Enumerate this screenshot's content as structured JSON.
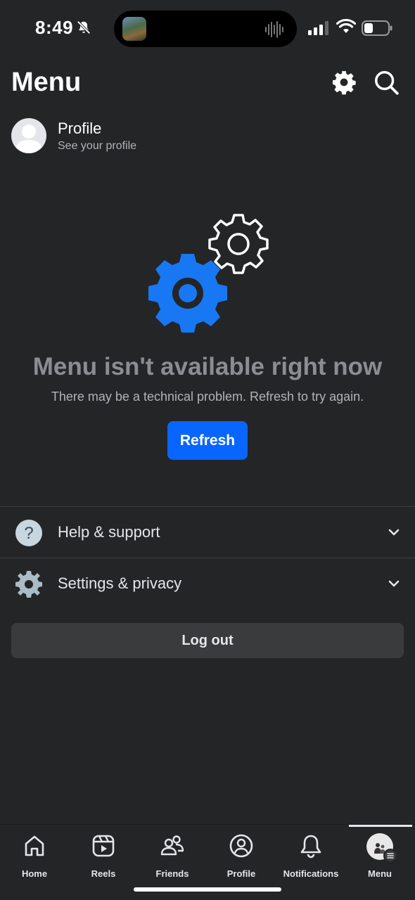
{
  "status_bar": {
    "time": "8:49",
    "icons": [
      "bell-slash-icon",
      "signal-icon",
      "wifi-icon",
      "battery-icon"
    ]
  },
  "header": {
    "title": "Menu",
    "icons": [
      "gear-icon",
      "search-icon"
    ]
  },
  "profile": {
    "name": "Profile",
    "subtitle": "See your profile"
  },
  "error": {
    "title": "Menu isn't available right now",
    "message": "There may be a technical problem. Refresh to try again.",
    "button_label": "Refresh",
    "illustration": "gears-icon"
  },
  "sections": [
    {
      "label": "Help & support",
      "icon": "question-circle-icon"
    },
    {
      "label": "Settings & privacy",
      "icon": "gear-icon"
    }
  ],
  "logout_label": "Log out",
  "bottom_nav": {
    "items": [
      {
        "label": "Home",
        "icon": "home-icon"
      },
      {
        "label": "Reels",
        "icon": "reels-icon"
      },
      {
        "label": "Friends",
        "icon": "friends-icon"
      },
      {
        "label": "Profile",
        "icon": "profile-icon"
      },
      {
        "label": "Notifications",
        "icon": "bell-icon"
      },
      {
        "label": "Menu",
        "icon": "menu-avatar-icon"
      }
    ],
    "active": "Menu"
  },
  "colors": {
    "background": "#242526",
    "accent": "#0866ff",
    "text": "#e4e6eb",
    "muted": "#b0b3b8"
  }
}
